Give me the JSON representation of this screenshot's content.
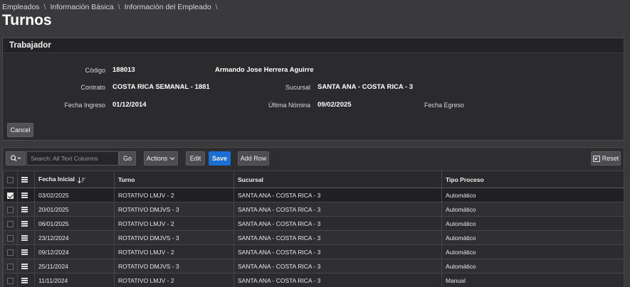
{
  "breadcrumb": [
    "Empleados",
    "Información Básica",
    "Información del Empleado"
  ],
  "page_title": "Turnos",
  "worker": {
    "title": "Trabajador",
    "codigo_label": "Código",
    "codigo_value": "188013",
    "nombre_value": "Armando Jose Herrera Aguirre",
    "contrato_label": "Contrato",
    "contrato_value": "COSTA RICA SEMANAL - 1881",
    "sucursal_label": "Sucursal",
    "sucursal_value": "SANTA ANA - COSTA RICA - 3",
    "fecha_ingreso_label": "Fecha Ingreso",
    "fecha_ingreso_value": "01/12/2014",
    "ultima_nomina_label": "Última Nómina",
    "ultima_nomina_value": "09/02/2025",
    "fecha_egreso_label": "Fecha Egreso",
    "cancel_label": "Cancel"
  },
  "toolbar": {
    "search_placeholder": "Search: All Text Columns",
    "go_label": "Go",
    "actions_label": "Actions",
    "edit_label": "Edit",
    "save_label": "Save",
    "add_row_label": "Add Row",
    "reset_label": "Reset"
  },
  "grid": {
    "columns": [
      "Fecha Inicial",
      "Turno",
      "Sucursal",
      "Tipo Proceso"
    ],
    "rows": [
      {
        "fecha": "03/02/2025",
        "turno": "ROTATIVO LMJV - 2",
        "sucursal": "SANTA ANA - COSTA RICA - 3",
        "tipo": "Automático",
        "checked": true
      },
      {
        "fecha": "20/01/2025",
        "turno": "ROTATIVO DMJVS - 3",
        "sucursal": "SANTA ANA - COSTA RICA - 3",
        "tipo": "Automático",
        "checked": false
      },
      {
        "fecha": "06/01/2025",
        "turno": "ROTATIVO LMJV - 2",
        "sucursal": "SANTA ANA - COSTA RICA - 3",
        "tipo": "Automático",
        "checked": false
      },
      {
        "fecha": "23/12/2024",
        "turno": "ROTATIVO DMJVS - 3",
        "sucursal": "SANTA ANA - COSTA RICA - 3",
        "tipo": "Automático",
        "checked": false
      },
      {
        "fecha": "09/12/2024",
        "turno": "ROTATIVO LMJV - 2",
        "sucursal": "SANTA ANA - COSTA RICA - 3",
        "tipo": "Automático",
        "checked": false
      },
      {
        "fecha": "25/11/2024",
        "turno": "ROTATIVO DMJVS - 3",
        "sucursal": "SANTA ANA - COSTA RICA - 3",
        "tipo": "Automático",
        "checked": false
      },
      {
        "fecha": "11/11/2024",
        "turno": "ROTATIVO LMJV - 2",
        "sucursal": "SANTA ANA - COSTA RICA - 3",
        "tipo": "Manual",
        "checked": false
      }
    ]
  },
  "colors": {
    "save_button": "#1a6fd4",
    "background": "#3a3a3d"
  },
  "icons": [
    "search-icon",
    "chevron-down-icon",
    "sort-descending-icon",
    "row-actions-icon",
    "reset-icon"
  ]
}
